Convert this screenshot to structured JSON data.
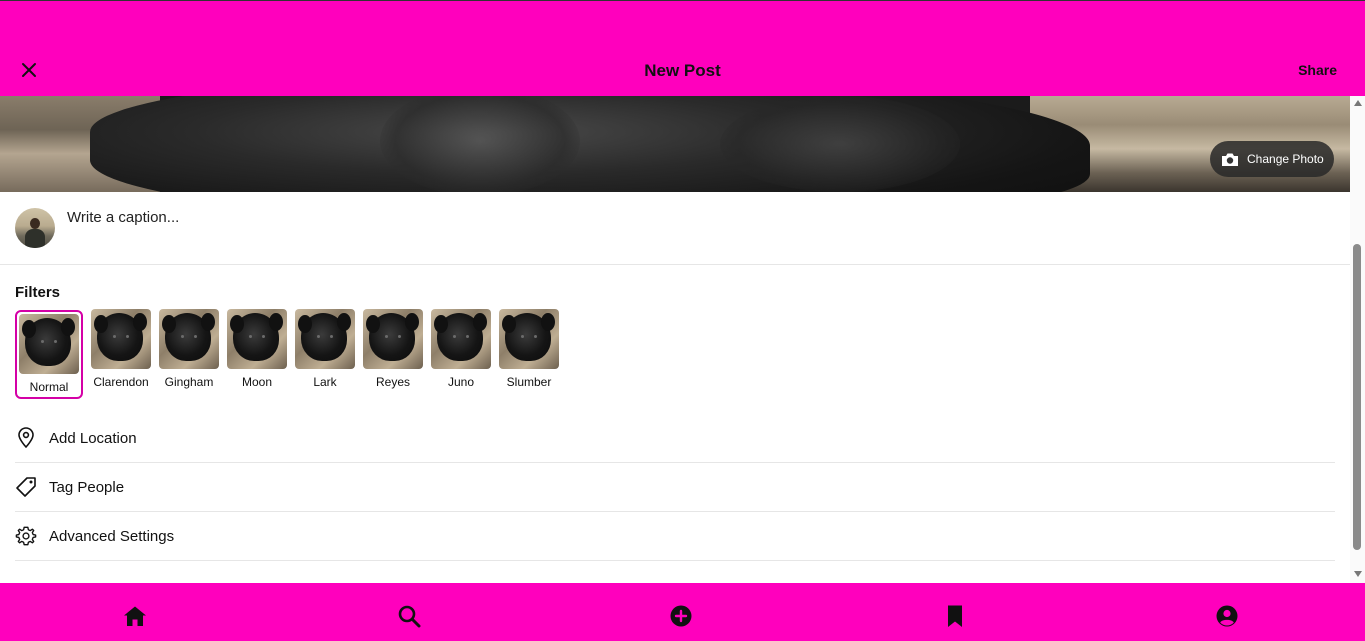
{
  "header": {
    "title": "New Post",
    "share_label": "Share",
    "close_icon": "close-icon",
    "background": "#ff00bd"
  },
  "photo": {
    "change_photo_label": "Change Photo",
    "camera_icon": "camera-icon"
  },
  "caption": {
    "placeholder": "Write a caption...",
    "value": ""
  },
  "filters": {
    "title": "Filters",
    "selected": "Normal",
    "accent": "#d400a6",
    "items": [
      {
        "label": "Normal"
      },
      {
        "label": "Clarendon"
      },
      {
        "label": "Gingham"
      },
      {
        "label": "Moon"
      },
      {
        "label": "Lark"
      },
      {
        "label": "Reyes"
      },
      {
        "label": "Juno"
      },
      {
        "label": "Slumber"
      }
    ]
  },
  "options": [
    {
      "label": "Add Location",
      "icon": "location-pin-icon"
    },
    {
      "label": "Tag People",
      "icon": "tag-icon"
    },
    {
      "label": "Advanced Settings",
      "icon": "gear-icon"
    }
  ],
  "bottom_nav": {
    "background": "#ff00bd",
    "items": [
      {
        "icon": "home-icon"
      },
      {
        "icon": "search-icon"
      },
      {
        "icon": "add-circle-icon"
      },
      {
        "icon": "bookmark-icon"
      },
      {
        "icon": "profile-icon"
      }
    ]
  }
}
